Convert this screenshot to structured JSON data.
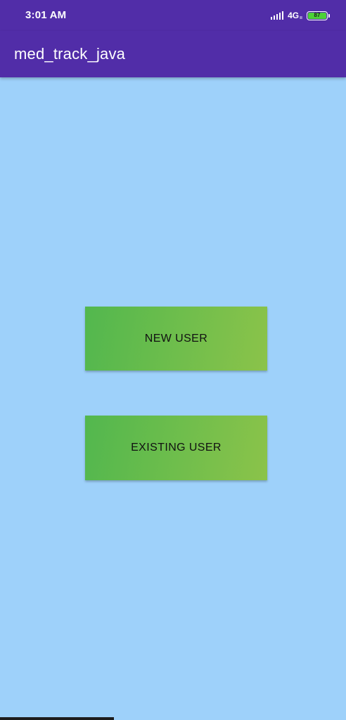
{
  "status_bar": {
    "time": "3:01 AM",
    "network": "4G",
    "network_sub": "ıı",
    "battery_level": "87",
    "signal_icon": "signal-bars-icon",
    "battery_icon": "battery-icon"
  },
  "app_bar": {
    "title": "med_track_java"
  },
  "main": {
    "new_user_label": "NEW USER",
    "existing_user_label": "EXISTING USER"
  },
  "colors": {
    "app_bar": "#512DA8",
    "background": "#9ED1FA",
    "button_gradient_start": "#52B74E",
    "button_gradient_end": "#8BC34A",
    "battery_fill": "#4CD137"
  }
}
